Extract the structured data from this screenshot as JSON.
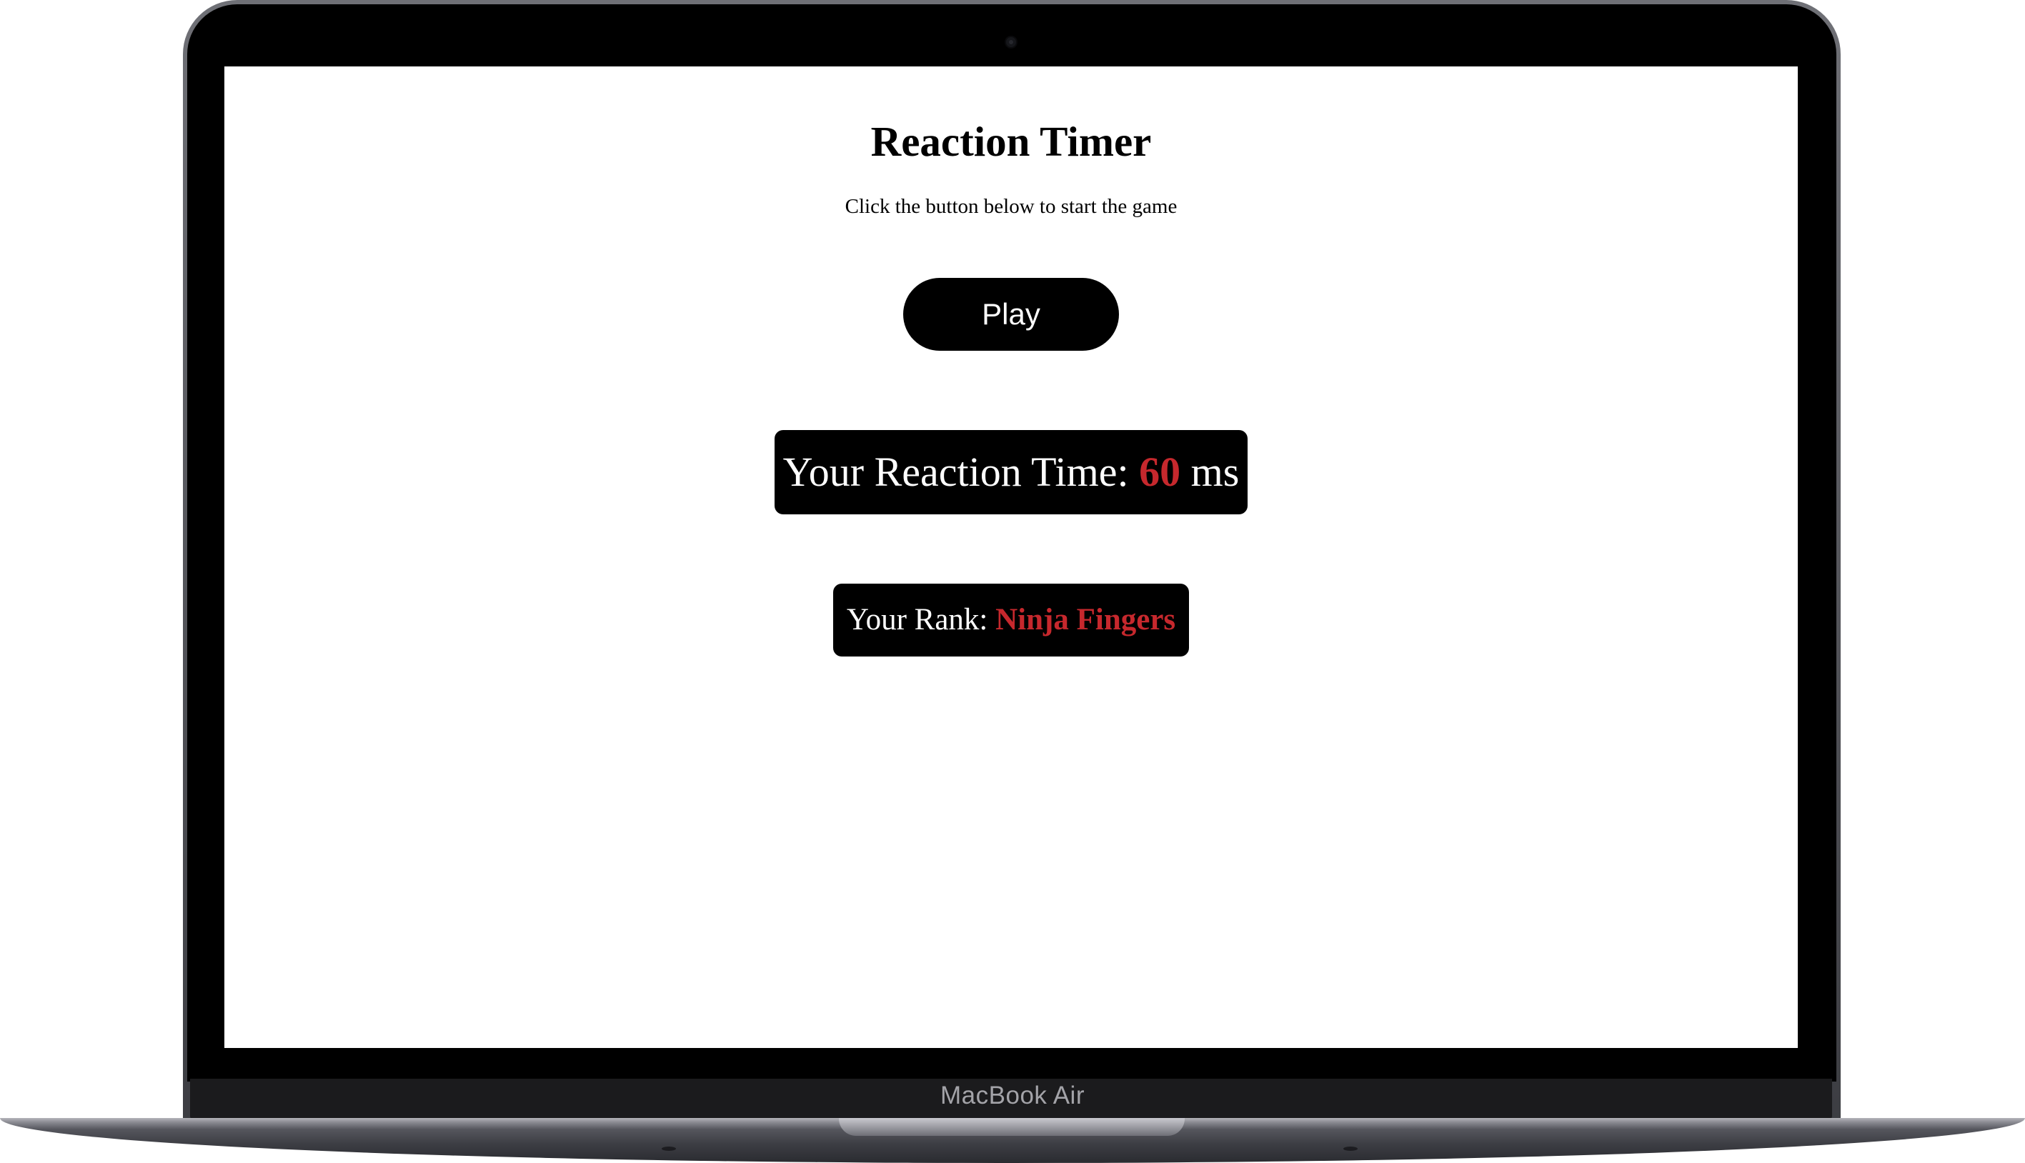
{
  "device": {
    "brand_label": "MacBook Air"
  },
  "game": {
    "title": "Reaction Timer",
    "instruction": "Click the button below to start the game",
    "play_label": "Play"
  },
  "result": {
    "reaction_prefix": "Your Reaction Time: ",
    "reaction_value": "60",
    "reaction_unit": " ms",
    "rank_prefix": "Your Rank: ",
    "rank_value": "Ninja Fingers"
  },
  "colors": {
    "accent": "#c6282d",
    "button_bg": "#000000",
    "button_text": "#ffffff",
    "screen_bg": "#ffffff"
  }
}
